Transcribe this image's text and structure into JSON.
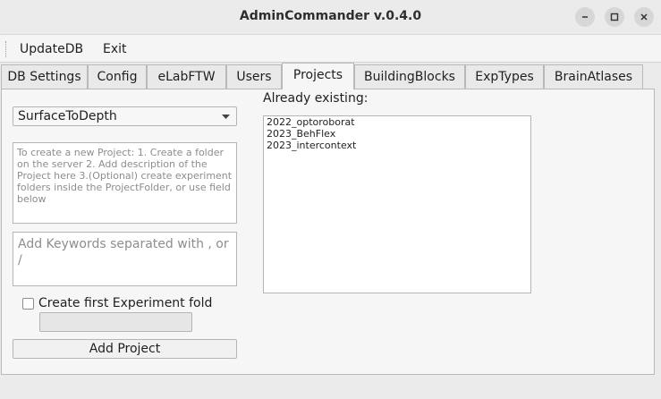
{
  "window": {
    "title": "AdminCommander v.0.4.0",
    "controls": [
      "minimize-icon",
      "maximize-icon",
      "close-icon"
    ]
  },
  "menubar": {
    "items": [
      "UpdateDB",
      "Exit"
    ]
  },
  "tabs": [
    {
      "label": "DB Settings",
      "active": false
    },
    {
      "label": "Config",
      "active": false
    },
    {
      "label": "eLabFTW",
      "active": false
    },
    {
      "label": "Users",
      "active": false
    },
    {
      "label": "Projects",
      "active": true
    },
    {
      "label": "BuildingBlocks",
      "active": false
    },
    {
      "label": "ExpTypes",
      "active": false
    },
    {
      "label": "BrainAtlases",
      "active": false
    }
  ],
  "projects": {
    "selected_project": "SurfaceToDepth",
    "description_placeholder": "To create a new Project:     1. Create a folder on the server       2. Add description of the Project here    3.(Optional) create experiment folders inside the ProjectFolder, or use field below",
    "keywords_placeholder": "Add Keywords separated with , or /",
    "first_experiment_label": "Create first Experiment fold",
    "first_experiment_checked": false,
    "first_experiment_value": "",
    "add_button_label": "Add Project",
    "existing_label": "Already existing:",
    "existing_items": [
      "2022_optoroborat",
      "2023_BehFlex",
      "2023_intercontext"
    ]
  }
}
